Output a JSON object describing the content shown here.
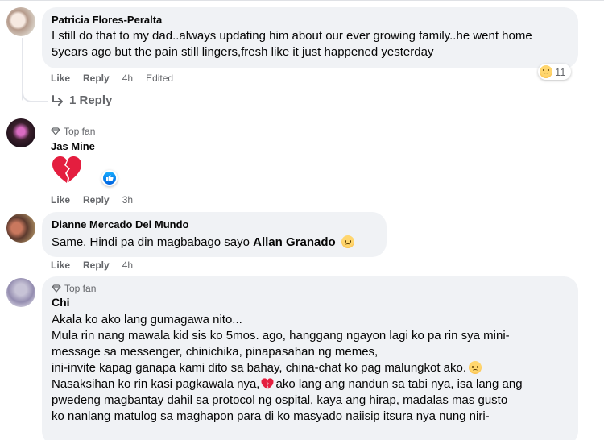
{
  "comments": [
    {
      "author": "Patricia Flores-Peralta",
      "text": "I still do that to my dad..always updating him about our ever growing family..he went home 5years ago but the pain still lingers,fresh like it just happened yesterday",
      "actions": {
        "like": "Like",
        "reply": "Reply",
        "time": "4h",
        "edited": "Edited"
      },
      "reaction": {
        "icon": "sad-reaction-icon",
        "count": "11"
      },
      "replies_link": "1 Reply"
    },
    {
      "badge": "Top fan",
      "author": "Jas Mine",
      "content_icon": "broken-heart-icon",
      "reaction": {
        "icon": "like-reaction-icon"
      },
      "actions": {
        "like": "Like",
        "reply": "Reply",
        "time": "3h"
      }
    },
    {
      "author": "Dianne Mercado Del Mundo",
      "text_prefix": "Same. Hindi pa din magbabago sayo",
      "mention": "Allan Granado",
      "actions": {
        "like": "Like",
        "reply": "Reply",
        "time": "4h"
      }
    },
    {
      "badge": "Top fan",
      "author": "Chi",
      "lines": [
        "Akala ko ako lang gumagawa nito...",
        "Mula rin nang mawala kid sis ko 5mos. ago, hanggang ngayon lagi ko pa rin sya mini-",
        "message sa messenger, chinichika, pinapasahan ng memes,",
        "ini-invite kapag ganapa kami dito sa bahay, china-chat ko pag malungkot ako.",
        "Nasaksihan ko rin kasi pagkawala nya,",
        "ako lang ang nandun sa tabi nya, isa lang ang",
        "pwedeng magbantay dahil sa protocol ng ospital, kaya ang hirap, madalas mas gusto",
        "ko nanlang matulog sa maghapon para di ko masyado naiisip itsura nya nung niri-"
      ]
    }
  ],
  "colors": {
    "bubble": "#f0f2f5",
    "meta": "#65676b",
    "like_blue": "#0866ff",
    "heart_red": "#e41e3f"
  }
}
